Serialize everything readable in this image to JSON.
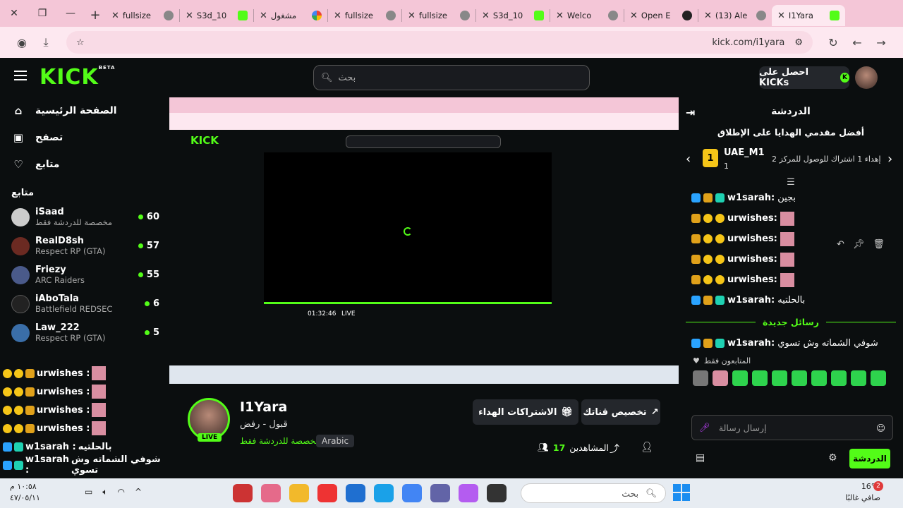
{
  "browser": {
    "tabs": [
      {
        "title": "fullsize",
        "icon": "globe-icon"
      },
      {
        "title": "S3d_10",
        "icon": "kick-icon"
      },
      {
        "title": "مشغول",
        "icon": "google-icon"
      },
      {
        "title": "fullsize",
        "icon": "globe-icon"
      },
      {
        "title": "fullsize",
        "icon": "globe-icon"
      },
      {
        "title": "S3d_10",
        "icon": "kick-icon"
      },
      {
        "title": "Welco",
        "icon": "globe-icon"
      },
      {
        "title": "Open E",
        "icon": "globe-icon"
      },
      {
        "title": "(13) Ale",
        "icon": "globe-icon"
      },
      {
        "title": "I1Yara",
        "icon": "kick-icon"
      }
    ],
    "url": "kick.com/i1yara"
  },
  "header": {
    "logo": "KICK",
    "logo_beta": "BETA",
    "search_placeholder": "بحث",
    "get_kicks": "احصل على KICKs",
    "accent": "#53fc18"
  },
  "sidebar": {
    "nav": [
      {
        "label": "الصفحة الرئيسية",
        "icon": "home-icon"
      },
      {
        "label": "تصفح",
        "icon": "browse-icon"
      },
      {
        "label": "متابع",
        "icon": "heart-icon"
      }
    ],
    "following_title": "متابع",
    "channels": [
      {
        "name": "iSaad",
        "category": "مخصصة للدردشة فقط",
        "viewers": "60"
      },
      {
        "name": "RealD8sh",
        "category": "Respect RP (GTA)",
        "viewers": "57"
      },
      {
        "name": "Friezy",
        "category": "ARC Raiders",
        "viewers": "55"
      },
      {
        "name": "iAboTala",
        "category": "Battlefield REDSEC",
        "viewers": "6"
      },
      {
        "name": "Law_222",
        "category": "Respect RP (GTA)",
        "viewers": "5"
      }
    ]
  },
  "overlay_chat": [
    {
      "name": "urwishes :",
      "text": ""
    },
    {
      "name": "urwishes :",
      "text": ""
    },
    {
      "name": "urwishes :",
      "text": ""
    },
    {
      "name": "urwishes :",
      "text": ""
    },
    {
      "name": "w1sarah :",
      "text": "بالحلتيه"
    },
    {
      "name": "w1sarah :",
      "text": "شوفي الشماته وش تسوي"
    }
  ],
  "stream": {
    "time": "01:32:46",
    "live": "LIVE",
    "streamer": "I1Yara",
    "title": "قبول - رفض",
    "category": "مخصصة للدردشة فقط",
    "language": "Arabic",
    "live_badge": "LIVE",
    "customize_btn": "تخصيص قناتك",
    "gift_btn": "الاشتراكات الهداء",
    "viewers_label": "المشاهدين",
    "viewers_count": "17"
  },
  "chat": {
    "title": "الدردشة",
    "top_gifters": "أفضل مقدمي الهدايا على الإطلاق",
    "gifter_name": "UAE_M1",
    "gifter_count": "1",
    "gifter_desc": "إهداء 1 اشتراك للوصول للمركز 2",
    "messages": [
      {
        "name": "w1sarah:",
        "text": "بجين"
      },
      {
        "name": "urwishes:",
        "text": ""
      },
      {
        "name": "urwishes:",
        "text": ""
      },
      {
        "name": "urwishes:",
        "text": ""
      },
      {
        "name": "urwishes:",
        "text": ""
      },
      {
        "name": "w1sarah:",
        "text": "بالحلتيه"
      }
    ],
    "new_messages": "رسائل جديدة",
    "latest": {
      "name": "w1sarah:",
      "text": "شوفي الشماته وش تسوي"
    },
    "followers_only": "المتابعون فقط",
    "input_placeholder": "إرسال رسالة",
    "send_btn": "الدردشة"
  },
  "taskbar": {
    "time": "١٠:٥٨ م",
    "date": "٤٧/٠٥/١١",
    "search_placeholder": "بحث",
    "temperature": "16°C",
    "weather": "صافي غالبًا",
    "notifications": "2"
  }
}
